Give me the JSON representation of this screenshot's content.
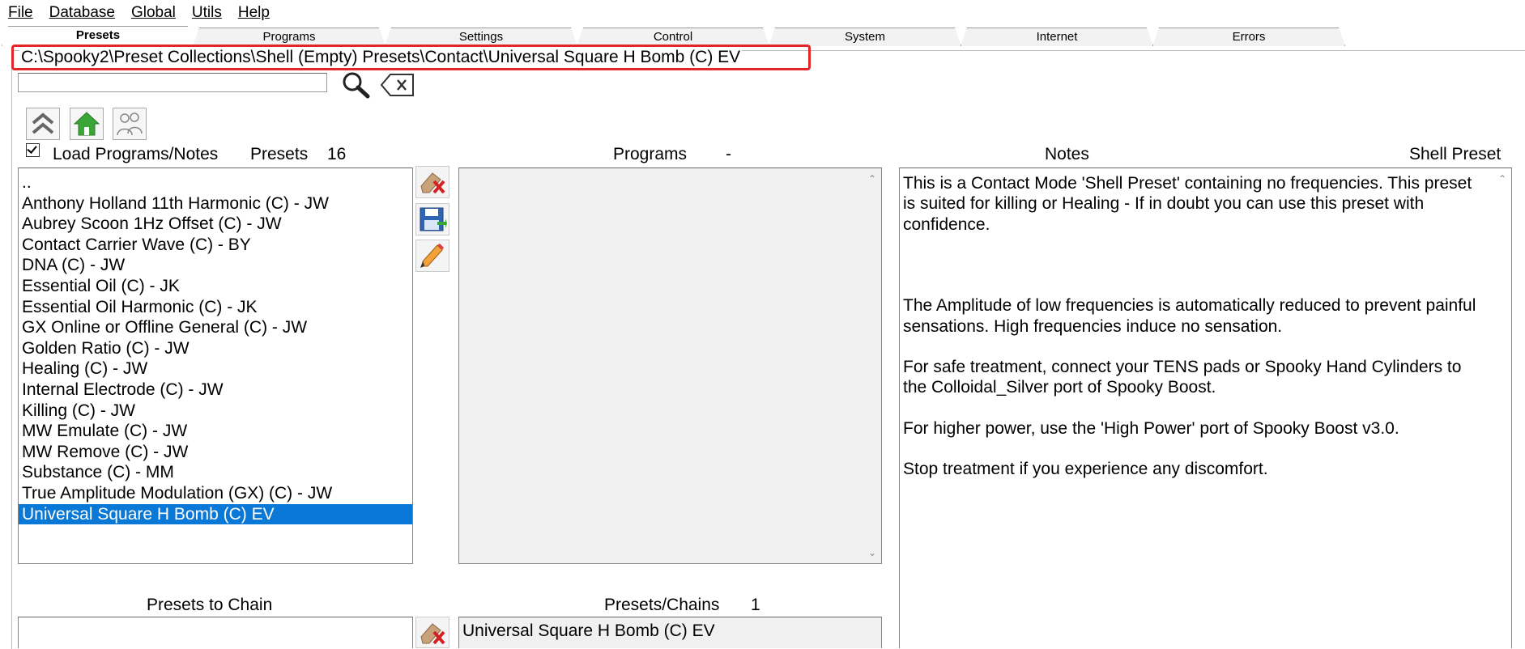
{
  "menu": {
    "items": [
      {
        "label": "File"
      },
      {
        "label": "Database"
      },
      {
        "label": "Global"
      },
      {
        "label": "Utils"
      },
      {
        "label": "Help"
      }
    ]
  },
  "tabs": [
    "Presets",
    "Programs",
    "Settings",
    "Control",
    "System",
    "Internet",
    "Errors"
  ],
  "path": "C:\\Spooky2\\Preset Collections\\Shell (Empty) Presets\\Contact\\Universal Square H Bomb (C) EV",
  "search": {
    "value": "",
    "placeholder": ""
  },
  "load_programs_label": "Load Programs/Notes",
  "presets_header": {
    "label": "Presets",
    "count": "16"
  },
  "programs_header": {
    "label": "Programs",
    "count": "-"
  },
  "notes_header": {
    "label": "Notes",
    "type": "Shell Preset"
  },
  "presets_list": [
    "..",
    "Anthony Holland 11th Harmonic (C) - JW",
    "Aubrey Scoon 1Hz Offset (C) - JW",
    "Contact Carrier Wave (C) - BY",
    "DNA (C) - JW",
    "Essential Oil (C) - JK",
    "Essential Oil Harmonic (C) - JK",
    "GX Online or Offline General (C) - JW",
    "Golden Ratio (C) - JW",
    "Healing (C) - JW",
    "Internal Electrode (C) - JW",
    "Killing (C) - JW",
    "MW Emulate (C) - JW",
    "MW Remove (C) - JW",
    "Substance (C) - MM",
    "True Amplitude Modulation (GX) (C) - JW",
    "Universal Square H Bomb (C) EV"
  ],
  "selected_preset_index": 16,
  "notes": [
    "This is a Contact Mode 'Shell Preset' containing no frequencies. This preset is suited for killing or Healing - If in doubt you can use this preset with confidence.",
    "",
    "The Amplitude of low frequencies is automatically reduced to prevent painful sensations. High frequencies induce no sensation.",
    "For safe treatment, connect your TENS pads or Spooky Hand Cylinders to the Colloidal_Silver port of Spooky Boost.",
    "For higher power, use the 'High Power' port of Spooky Boost v3.0.",
    "Stop treatment if you experience any discomfort."
  ],
  "chain_header": {
    "label": "Presets to Chain"
  },
  "presets_chains_header": {
    "label": "Presets/Chains",
    "count": "1"
  },
  "presets_chains_list": [
    "Universal Square H Bomb (C) EV"
  ],
  "colors": {
    "selection": "#0a78d7",
    "highlight_border": "#e32626"
  },
  "icons": {
    "up": "up-chevron-icon",
    "home": "home-icon",
    "users": "users-icon",
    "search": "search-icon",
    "clear": "backspace-clear-icon",
    "delete": "eraser-delete-icon",
    "save": "floppy-save-icon",
    "edit": "pencil-edit-icon"
  }
}
